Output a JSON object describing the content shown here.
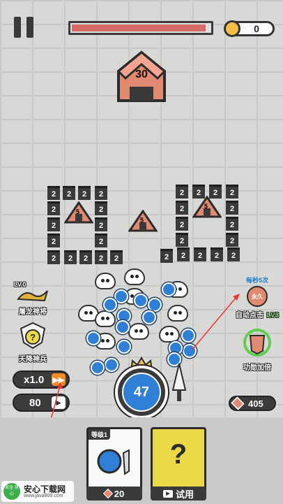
{
  "hud": {
    "coins": "0",
    "boss_hp_fraction": 0.97
  },
  "boss": {
    "hp": "30"
  },
  "enemy_tents": {
    "left_label": "5",
    "mid_label": "5",
    "right_label": "5"
  },
  "blocks": {
    "value": "2"
  },
  "side_left": {
    "dragon_level": "LV.0",
    "dragon_label": "屠龙神将",
    "soldier_label": "天降神兵"
  },
  "side_right": {
    "auto_top": "每秒5次",
    "auto_icon_text": "永久",
    "auto_label": "自动点击",
    "auto_level": "LV3",
    "power_label": "功勋加倍"
  },
  "controls": {
    "speed": "x1.0",
    "ads_count": "80",
    "gems": "405"
  },
  "launcher": {
    "ball_count": "47"
  },
  "cards": {
    "weapon_level": "等级1",
    "weapon_cost": "20",
    "mystery_symbol": "?",
    "mystery_action": "试用"
  },
  "watermark": {
    "logo_text": "安全 放心",
    "title": "安心下载网",
    "url": "www.java800.com"
  },
  "colors": {
    "ball_blue": "#2f7fd6",
    "boss_salmon": "#e08a72",
    "hp_red": "#d96a6a",
    "card_yellow": "#ecd94a",
    "block_dark": "#3a3a3a"
  },
  "icons": [
    "pause-icon",
    "coin-icon",
    "video-ad-icon",
    "gem-icon",
    "crown-icon",
    "shield-icon",
    "sword-icon"
  ]
}
